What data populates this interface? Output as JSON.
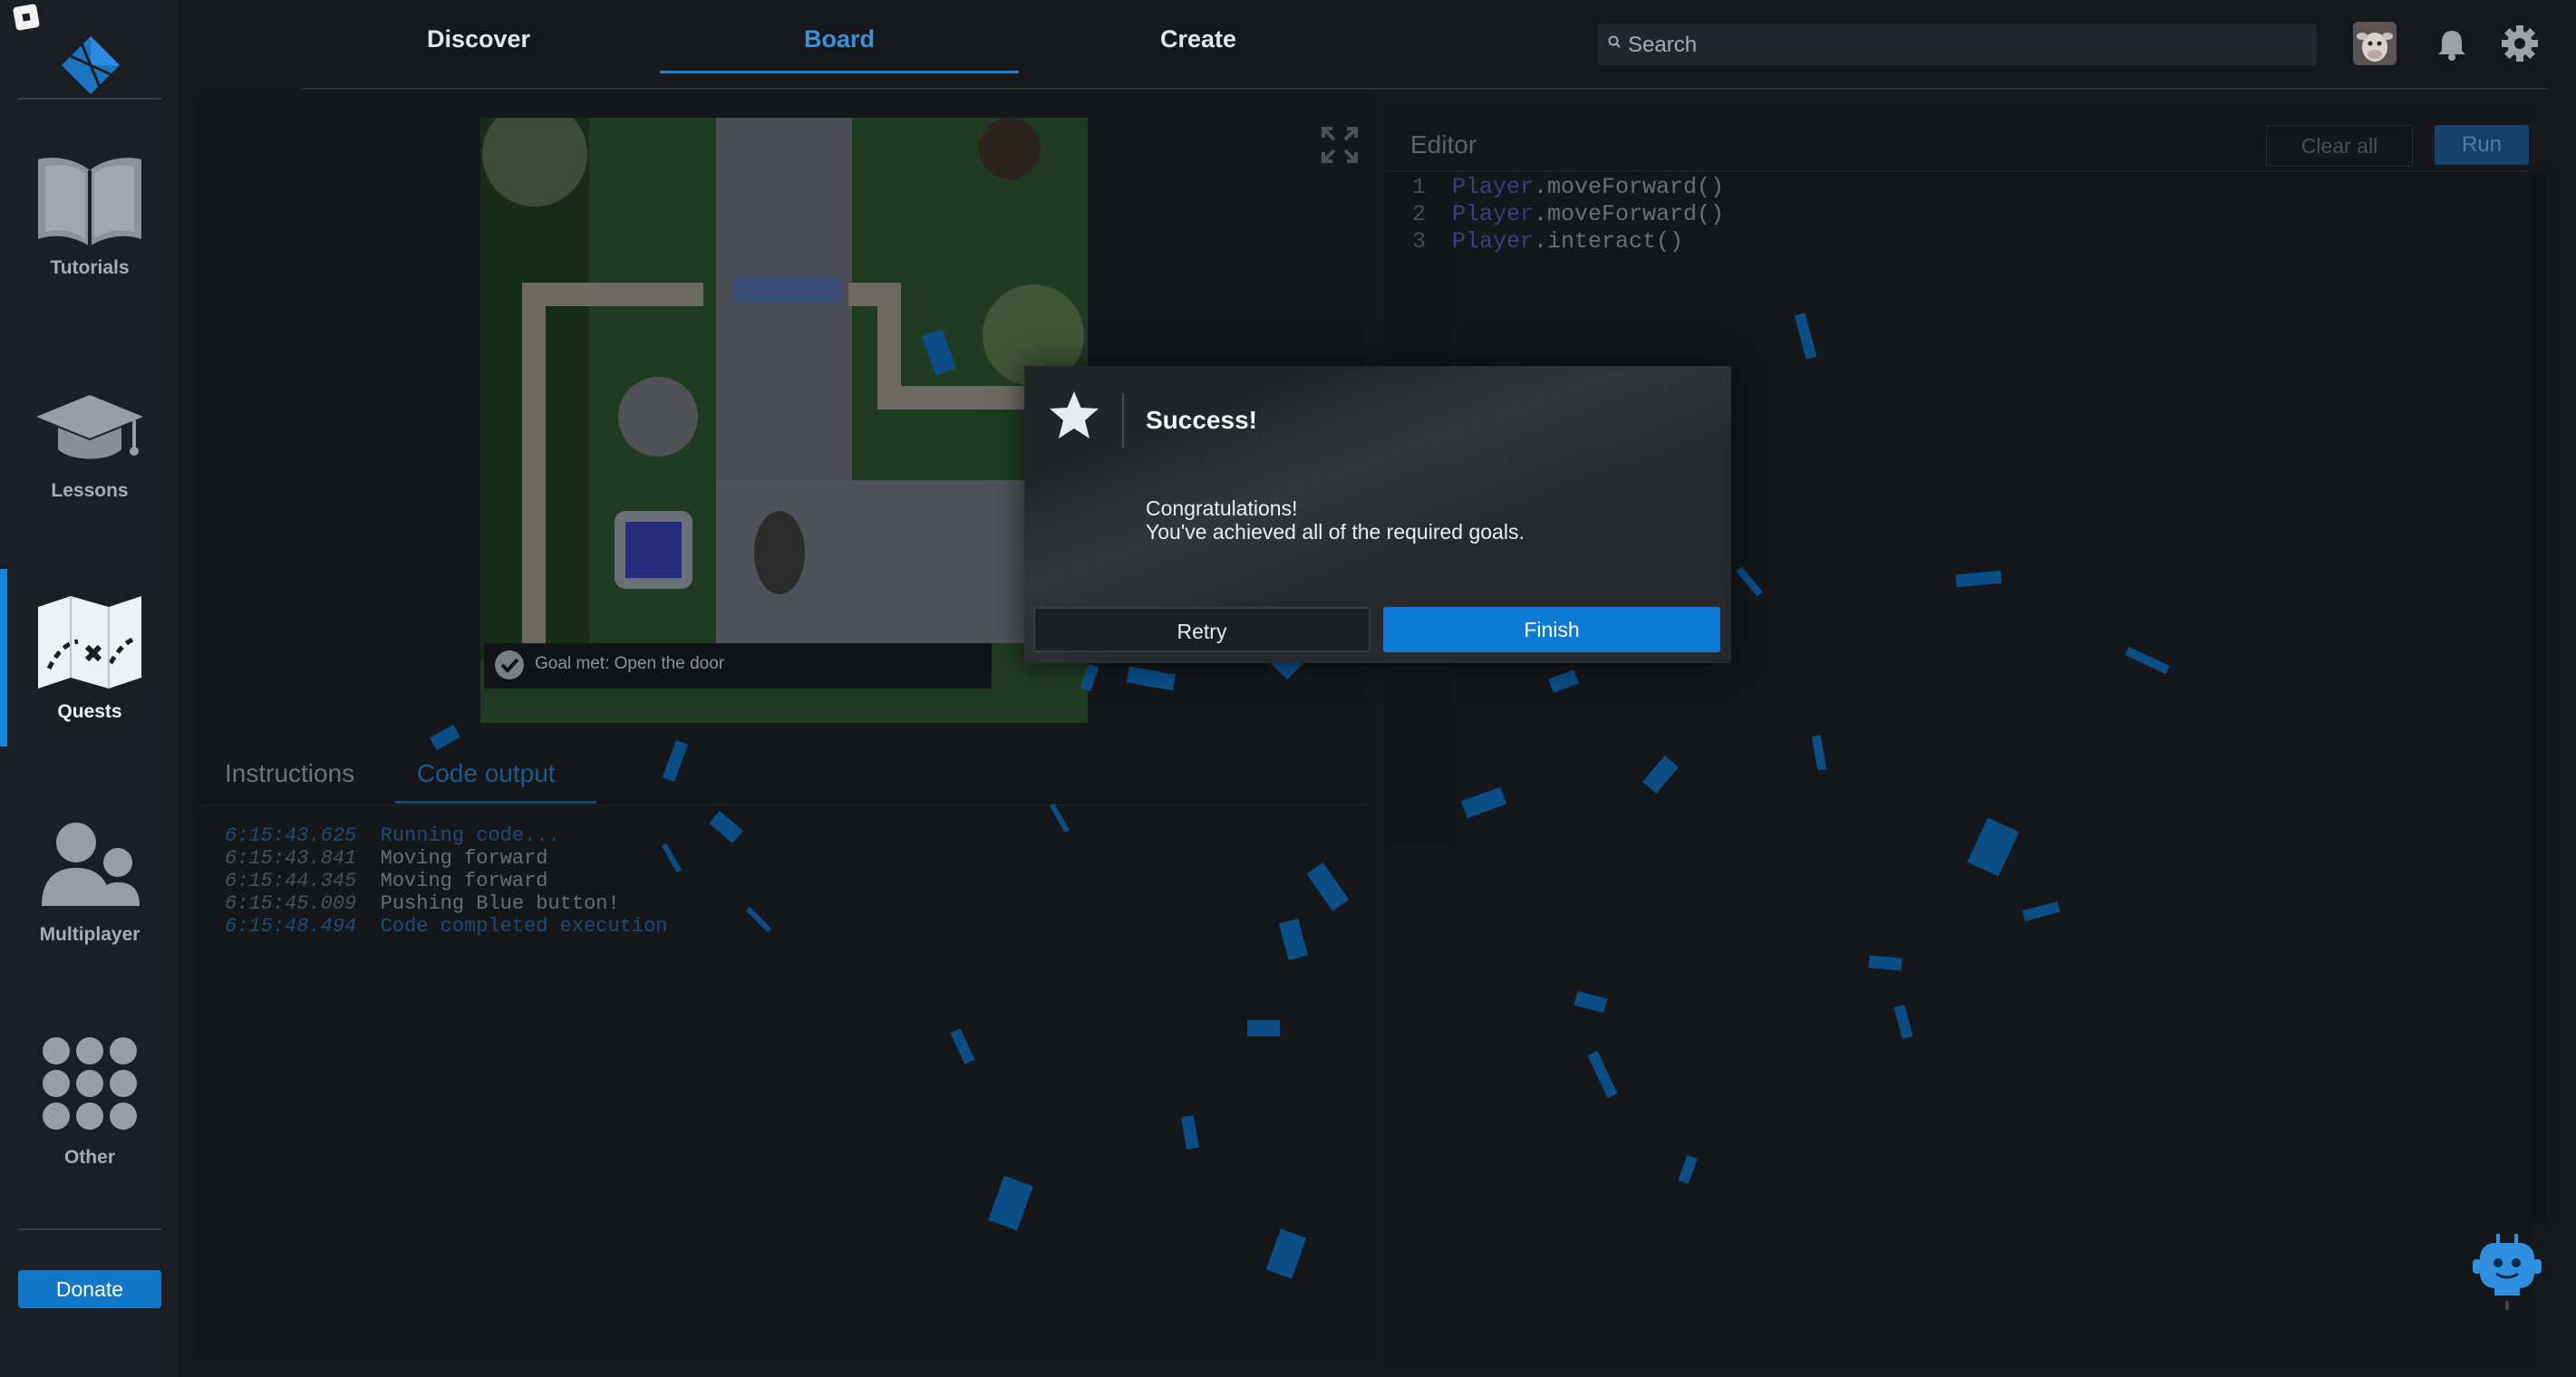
{
  "nav": {
    "tabs": [
      {
        "label": "Discover"
      },
      {
        "label": "Board"
      },
      {
        "label": "Create"
      }
    ],
    "active_tab": "Board"
  },
  "search": {
    "placeholder": "Search"
  },
  "sidebar": {
    "items": [
      {
        "label": "Tutorials",
        "icon": "book-icon"
      },
      {
        "label": "Lessons",
        "icon": "graduation-cap-icon"
      },
      {
        "label": "Quests",
        "icon": "treasure-map-icon"
      },
      {
        "label": "Multiplayer",
        "icon": "people-icon"
      },
      {
        "label": "Other",
        "icon": "grid-dots-icon"
      }
    ],
    "active": "Quests",
    "donate_label": "Donate"
  },
  "game": {
    "goal_text": "Goal met: Open the door"
  },
  "bottom_tabs": {
    "instructions": "Instructions",
    "code_output": "Code output"
  },
  "log": [
    {
      "time": "6:15:43.625",
      "message": "Running code...",
      "style": "info"
    },
    {
      "time": "6:15:43.841",
      "message": "Moving forward",
      "style": "normal"
    },
    {
      "time": "6:15:44.345",
      "message": "Moving forward",
      "style": "normal"
    },
    {
      "time": "6:15:45.009",
      "message": "Pushing Blue button!",
      "style": "normal"
    },
    {
      "time": "6:15:48.494",
      "message": "Code completed execution",
      "style": "info"
    }
  ],
  "editor": {
    "title": "Editor",
    "clear_label": "Clear all",
    "run_label": "Run",
    "lines": [
      {
        "num": "1",
        "object": "Player",
        "call": ".moveForward()"
      },
      {
        "num": "2",
        "object": "Player",
        "call": ".moveForward()"
      },
      {
        "num": "3",
        "object": "Player",
        "call": ".interact()"
      }
    ]
  },
  "modal": {
    "title": "Success!",
    "message_line1": "Congratulations!",
    "message_line2": "You've achieved all of the required goals.",
    "retry_label": "Retry",
    "finish_label": "Finish"
  },
  "colors": {
    "accent": "#0f7ad3",
    "background": "#16181c",
    "sidebar": "#1b1e23",
    "confetti": "#0b4e86"
  }
}
